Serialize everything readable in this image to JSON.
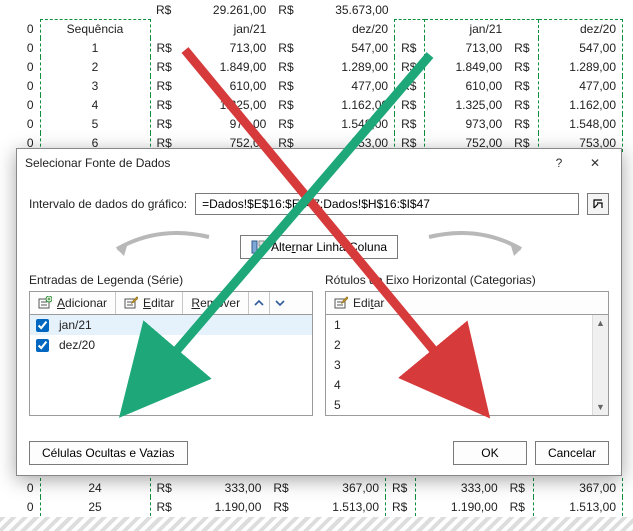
{
  "sheet": {
    "seq_header": "Sequência",
    "col_headers": [
      "jan/21",
      "dez/20",
      "jan/21",
      "dez/20"
    ],
    "top_totals": [
      "R$",
      "29.261,00",
      "R$",
      "35.673,00"
    ],
    "rows": [
      {
        "seq": "1",
        "c": [
          "R$",
          "713,00",
          "R$",
          "547,00",
          "R$",
          "713,00",
          "R$",
          "547,00"
        ]
      },
      {
        "seq": "2",
        "c": [
          "R$",
          "1.849,00",
          "R$",
          "1.289,00",
          "R$",
          "1.849,00",
          "R$",
          "1.289,00"
        ]
      },
      {
        "seq": "3",
        "c": [
          "R$",
          "610,00",
          "R$",
          "477,00",
          "R$",
          "610,00",
          "R$",
          "477,00"
        ]
      },
      {
        "seq": "4",
        "c": [
          "R$",
          "1.325,00",
          "R$",
          "1.162,00",
          "R$",
          "1.325,00",
          "R$",
          "1.162,00"
        ]
      },
      {
        "seq": "5",
        "c": [
          "R$",
          "973,00",
          "R$",
          "1.548,00",
          "R$",
          "973,00",
          "R$",
          "1.548,00"
        ]
      },
      {
        "seq": "6",
        "c": [
          "R$",
          "752,00",
          "R$",
          "753,00",
          "R$",
          "752,00",
          "R$",
          "753,00"
        ]
      }
    ],
    "bottom_rows": [
      {
        "seq": "24",
        "c": [
          "R$",
          "333,00",
          "R$",
          "367,00",
          "R$",
          "333,00",
          "R$",
          "367,00"
        ]
      },
      {
        "seq": "25",
        "c": [
          "R$",
          "1.190,00",
          "R$",
          "1.513,00",
          "R$",
          "1.190,00",
          "R$",
          "1.513,00"
        ]
      }
    ]
  },
  "dialog": {
    "title": "Selecionar Fonte de Dados",
    "help_symbol": "?",
    "close_symbol": "✕",
    "range_label": "Intervalo de dados do gráfico:",
    "range_value": "=Dados!$E$16:$E$47;Dados!$H$16:$I$47",
    "switch_label": "Alternar Linha/Coluna",
    "series_title": "Entradas de Legenda (Série)",
    "categories_title": "Rótulos do Eixo Horizontal (Categorias)",
    "btn_add": "Adicionar",
    "btn_edit": "Editar",
    "btn_remove": "Remover",
    "btn_edit2": "Editar",
    "series_items": [
      "jan/21",
      "dez/20"
    ],
    "category_items": [
      "1",
      "2",
      "3",
      "4",
      "5"
    ],
    "hidden_cells": "Células Ocultas e Vazias",
    "ok": "OK",
    "cancel": "Cancelar"
  }
}
